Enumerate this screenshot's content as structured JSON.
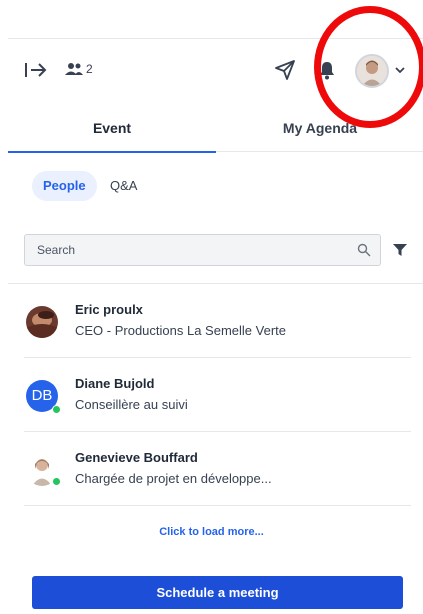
{
  "toolbar": {
    "attendee_count": "2",
    "icons": [
      "exit-icon",
      "people-icon",
      "send-icon",
      "bell-icon",
      "avatar",
      "chevron-down-icon"
    ]
  },
  "tabs": [
    {
      "label": "Event",
      "active": true
    },
    {
      "label": "My Agenda",
      "active": false
    }
  ],
  "subtabs": [
    {
      "label": "People",
      "active": true
    },
    {
      "label": "Q&A",
      "active": false
    }
  ],
  "search": {
    "placeholder": "Search",
    "value": ""
  },
  "people": [
    {
      "name": "Eric proulx",
      "title": "CEO - Productions La Semelle Verte",
      "online": false
    },
    {
      "name": "Diane Bujold",
      "title": "Conseillère au suivi",
      "initials": "DB",
      "online": true
    },
    {
      "name": "Genevieve Bouffard",
      "title": "Chargée de projet en développe...",
      "online": true
    }
  ],
  "load_more": "Click to load more...",
  "schedule_button": "Schedule a meeting",
  "colors": {
    "accent": "#2563eb",
    "highlight": "#ee0a0a",
    "online": "#22c55e"
  }
}
